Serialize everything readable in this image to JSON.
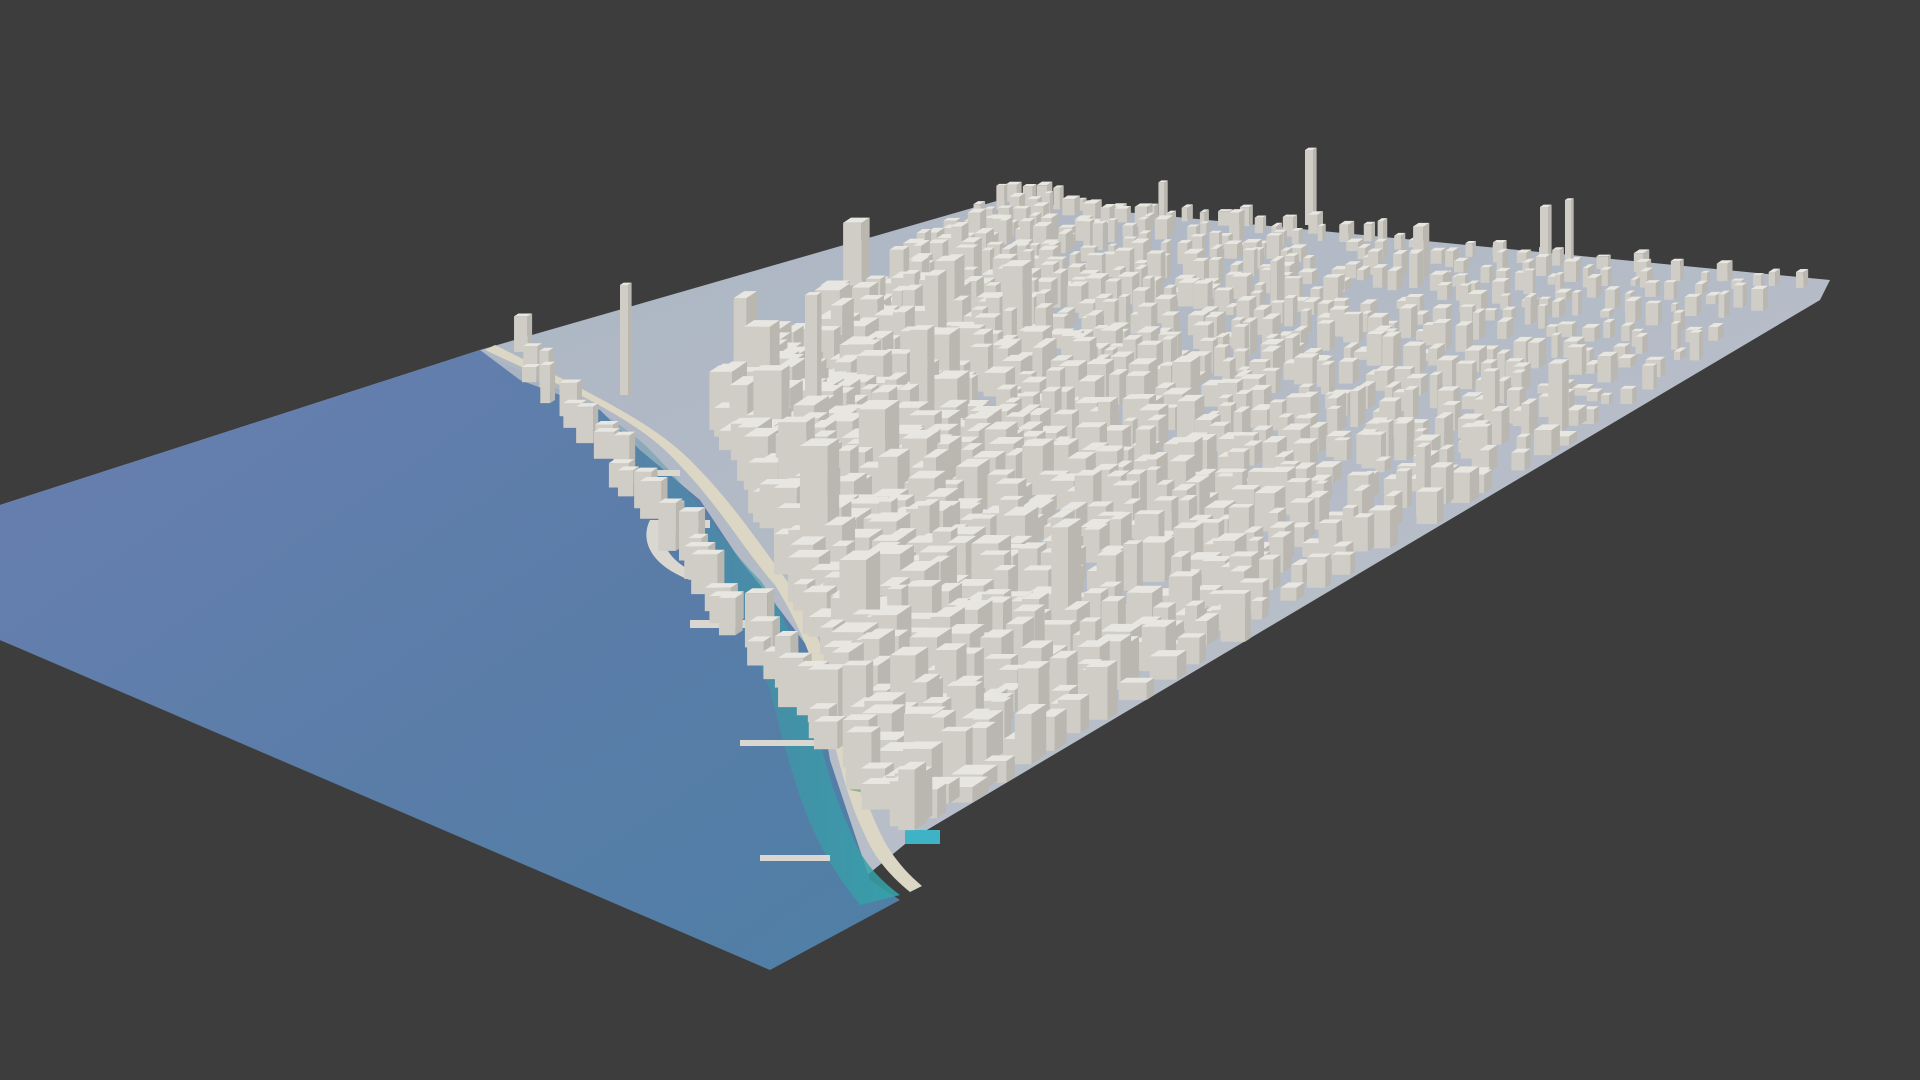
{
  "viewport": {
    "background_color": "#3d3d3d"
  },
  "scene": {
    "subject": "3d-city-model",
    "water_color": "#5878a0",
    "shallow_water_color": "#3aa0a8",
    "beach_color": "#d8d2c0",
    "terrain_color": "#b8bcc4",
    "building_top_color": "#e8e6e0",
    "building_left_color": "#cfcdc6",
    "building_right_color": "#b9b7b0",
    "park_color": "#8aa878"
  }
}
